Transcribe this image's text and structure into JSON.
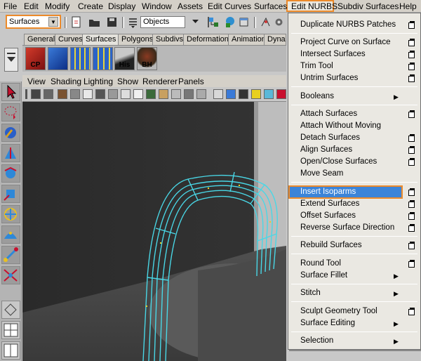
{
  "menubar": {
    "items": [
      "File",
      "Edit",
      "Modify",
      "Create",
      "Display",
      "Window",
      "Assets",
      "Edit Curves",
      "Surfaces",
      "Edit NURBS",
      "Subdiv Surfaces",
      "Help"
    ]
  },
  "toolbar": {
    "mode": "Surfaces",
    "objects_field": "Objects"
  },
  "shelf": {
    "tabs": [
      "General",
      "Curves",
      "Surfaces",
      "Polygons",
      "Subdivs",
      "Deformation",
      "Animation",
      "Dynam"
    ],
    "active_tab": "Surfaces",
    "buttons": [
      "CP",
      "",
      "",
      "",
      "His",
      "BH"
    ]
  },
  "panel_menu": {
    "items": [
      "View",
      "Shading",
      "Lighting",
      "Show",
      "Renderer",
      "Panels"
    ]
  },
  "dropdown": {
    "items": [
      "Duplicate NURBS Patches",
      "Project Curve on Surface",
      "Intersect Surfaces",
      "Trim Tool",
      "Untrim Surfaces",
      "Booleans",
      "Attach Surfaces",
      "Attach Without Moving",
      "Detach Surfaces",
      "Align Surfaces",
      "Open/Close Surfaces",
      "Move Seam",
      "Insert Isoparms",
      "Extend Surfaces",
      "Offset Surfaces",
      "Reverse Surface Direction",
      "Rebuild Surfaces",
      "Round Tool",
      "Surface Fillet",
      "Stitch",
      "Sculpt Geometry Tool",
      "Surface Editing",
      "Selection"
    ],
    "highlighted": "Insert Isoparms"
  },
  "colors": {
    "highlight_border": "#ec8a2a",
    "selection": "#3c84d8",
    "nurbs_wire": "#49d7e6"
  }
}
